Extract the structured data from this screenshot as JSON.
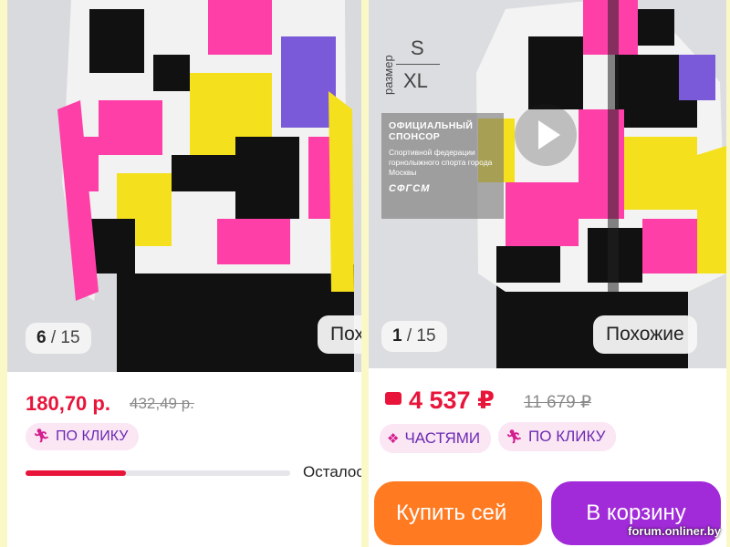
{
  "left_card": {
    "photo_counter": {
      "current": "6",
      "total": "15"
    },
    "similar_label": "Пох",
    "price": "180,70 р.",
    "old_price": "432,49 р.",
    "badge_click": "ПО КЛИКУ",
    "stock_progress": 0.38,
    "remain_text": "Осталос"
  },
  "right_card": {
    "size_caption": "размер",
    "size_small": "S",
    "size_large": "XL",
    "sponsor_title": "ОФИЦИАЛЬНЫЙ СПОНСОР",
    "sponsor_text": "Спортивной федерации горнолыжного спорта города Москвы",
    "sponsor_logo": "СФГСМ",
    "photo_counter": {
      "current": "1",
      "total": "15"
    },
    "similar_label": "Похожие",
    "price": "4 537 ₽",
    "old_price": "11 679 ₽",
    "badge_parts": "ЧАСТЯМИ",
    "badge_click": "ПО КЛИКУ",
    "buy_button": "Купить сей",
    "cart_button": "В корзину"
  },
  "watermark": "forum.onliner.by",
  "colors": {
    "price_red": "#e8143a",
    "buy_orange": "#ff7a21",
    "cart_purple": "#a12bd8",
    "pill_bg": "#fbe6f4",
    "page_bg": "#fbf8c8"
  },
  "icons": [
    "running-person-icon",
    "wallet-icon",
    "parts-icon",
    "play-icon"
  ]
}
